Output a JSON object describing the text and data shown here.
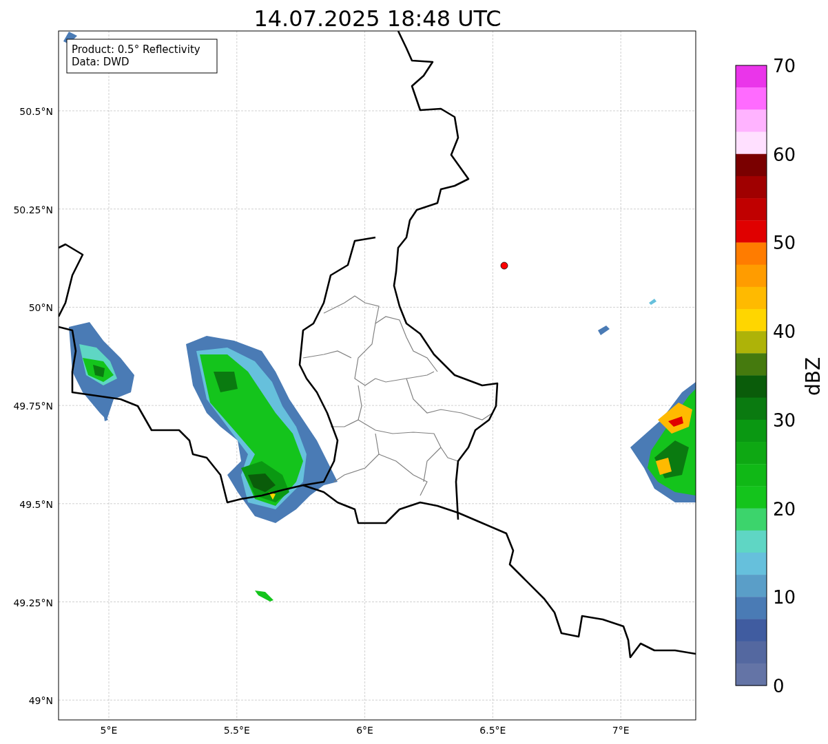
{
  "title": "14.07.2025 18:48 UTC",
  "info_box": {
    "lines": [
      "Product: 0.5° Reflectivity",
      "Data: DWD"
    ]
  },
  "y_ticks": [
    "50.5°N",
    "50.25°N",
    "50°N",
    "49.75°N",
    "49.5°N",
    "49.25°N",
    "49°N"
  ],
  "x_ticks": [
    "5°E",
    "5.5°E",
    "6°E",
    "6.5°E",
    "7°E"
  ],
  "colorbar": {
    "label": "dBZ",
    "ticks": [
      "70",
      "60",
      "50",
      "40",
      "30",
      "20",
      "10",
      "0"
    ],
    "segments": [
      {
        "color": "#ea35ea"
      },
      {
        "color": "#ff6bff"
      },
      {
        "color": "#ffb3ff"
      },
      {
        "color": "#ffe0ff"
      },
      {
        "color": "#7a0000"
      },
      {
        "color": "#a00000"
      },
      {
        "color": "#c00000"
      },
      {
        "color": "#e00000"
      },
      {
        "color": "#ff7c00"
      },
      {
        "color": "#ff9c00"
      },
      {
        "color": "#ffba00"
      },
      {
        "color": "#ffd600"
      },
      {
        "color": "#aeb308"
      },
      {
        "color": "#457a0e"
      },
      {
        "color": "#0a5c0a"
      },
      {
        "color": "#0a7a10"
      },
      {
        "color": "#0a9812"
      },
      {
        "color": "#0ea813"
      },
      {
        "color": "#10b816"
      },
      {
        "color": "#14c41c"
      },
      {
        "color": "#3cd46c"
      },
      {
        "color": "#5fd6c4"
      },
      {
        "color": "#66c0dc"
      },
      {
        "color": "#5a9ec8"
      },
      {
        "color": "#4a7bb5"
      },
      {
        "color": "#405ca0"
      },
      {
        "color": "#5468a0"
      },
      {
        "color": "#6474a6"
      }
    ]
  }
}
